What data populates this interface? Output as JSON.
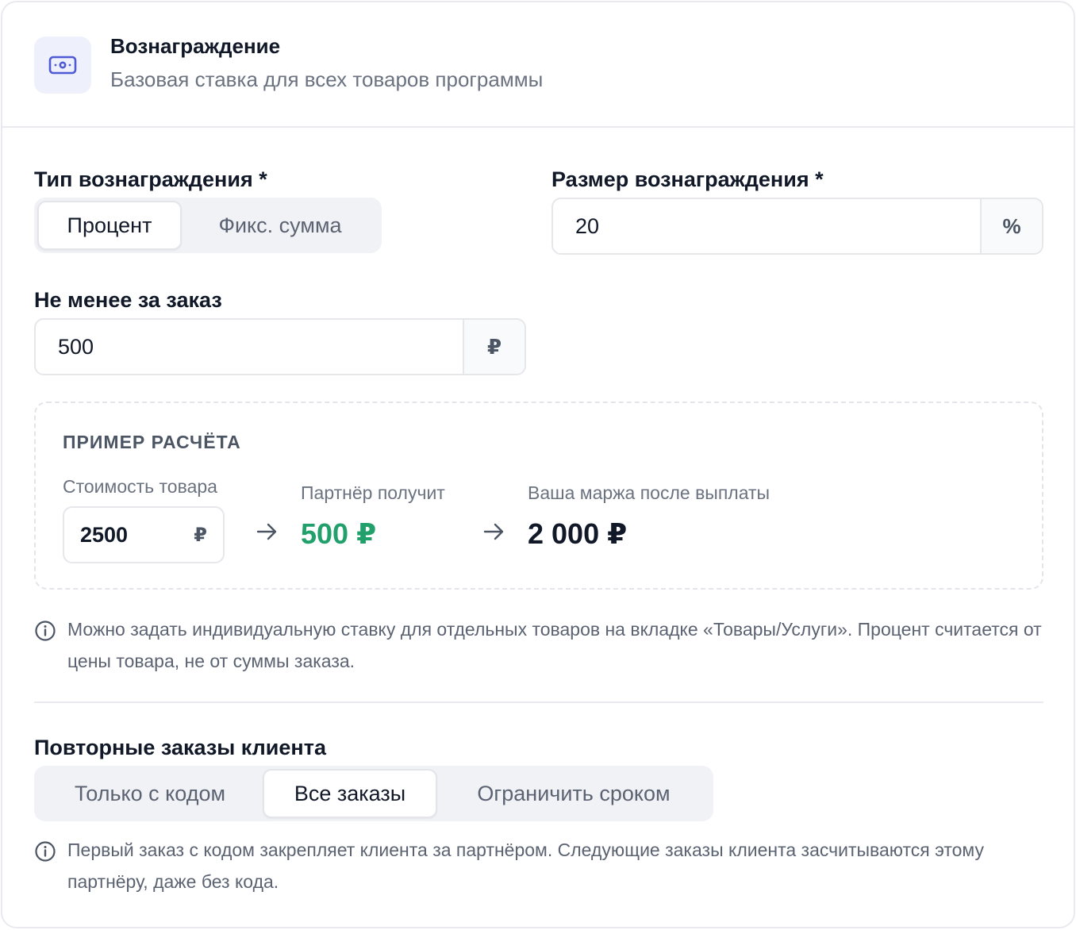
{
  "header": {
    "icon": "banknote-icon",
    "title": "Вознаграждение",
    "subtitle": "Базовая ставка для всех товаров программы"
  },
  "reward_type": {
    "label": "Тип вознаграждения *",
    "options": [
      "Процент",
      "Фикс. сумма"
    ],
    "selected": "Процент"
  },
  "reward_size": {
    "label": "Размер вознаграждения *",
    "value": "20",
    "unit": "%"
  },
  "min_per_order": {
    "label": "Не менее за заказ",
    "value": "500",
    "unit": "₽"
  },
  "example": {
    "title": "ПРИМЕР РАСЧЁТА",
    "price_label": "Стоимость товара",
    "price_value": "2500",
    "price_unit": "₽",
    "partner_label": "Партнёр получит",
    "partner_value": "500 ₽",
    "margin_label": "Ваша маржа после выплаты",
    "margin_value": "2 000 ₽"
  },
  "note_rate": "Можно задать индивидуальную ставку для отдельных товаров на вкладке «Товары/Услуги». Процент считается от цены товара, не от суммы заказа.",
  "repeat_orders": {
    "label": "Повторные заказы клиента",
    "options": [
      "Только с кодом",
      "Все заказы",
      "Ограничить сроком"
    ],
    "selected": "Все заказы"
  },
  "note_repeat": "Первый заказ с кодом закрепляет клиента за партнёром. Следующие заказы клиента засчитываются этому партнёру, даже без кода.",
  "colors": {
    "accent": "#4f5bd5",
    "success": "#22a06b",
    "border": "#e5e7eb"
  }
}
